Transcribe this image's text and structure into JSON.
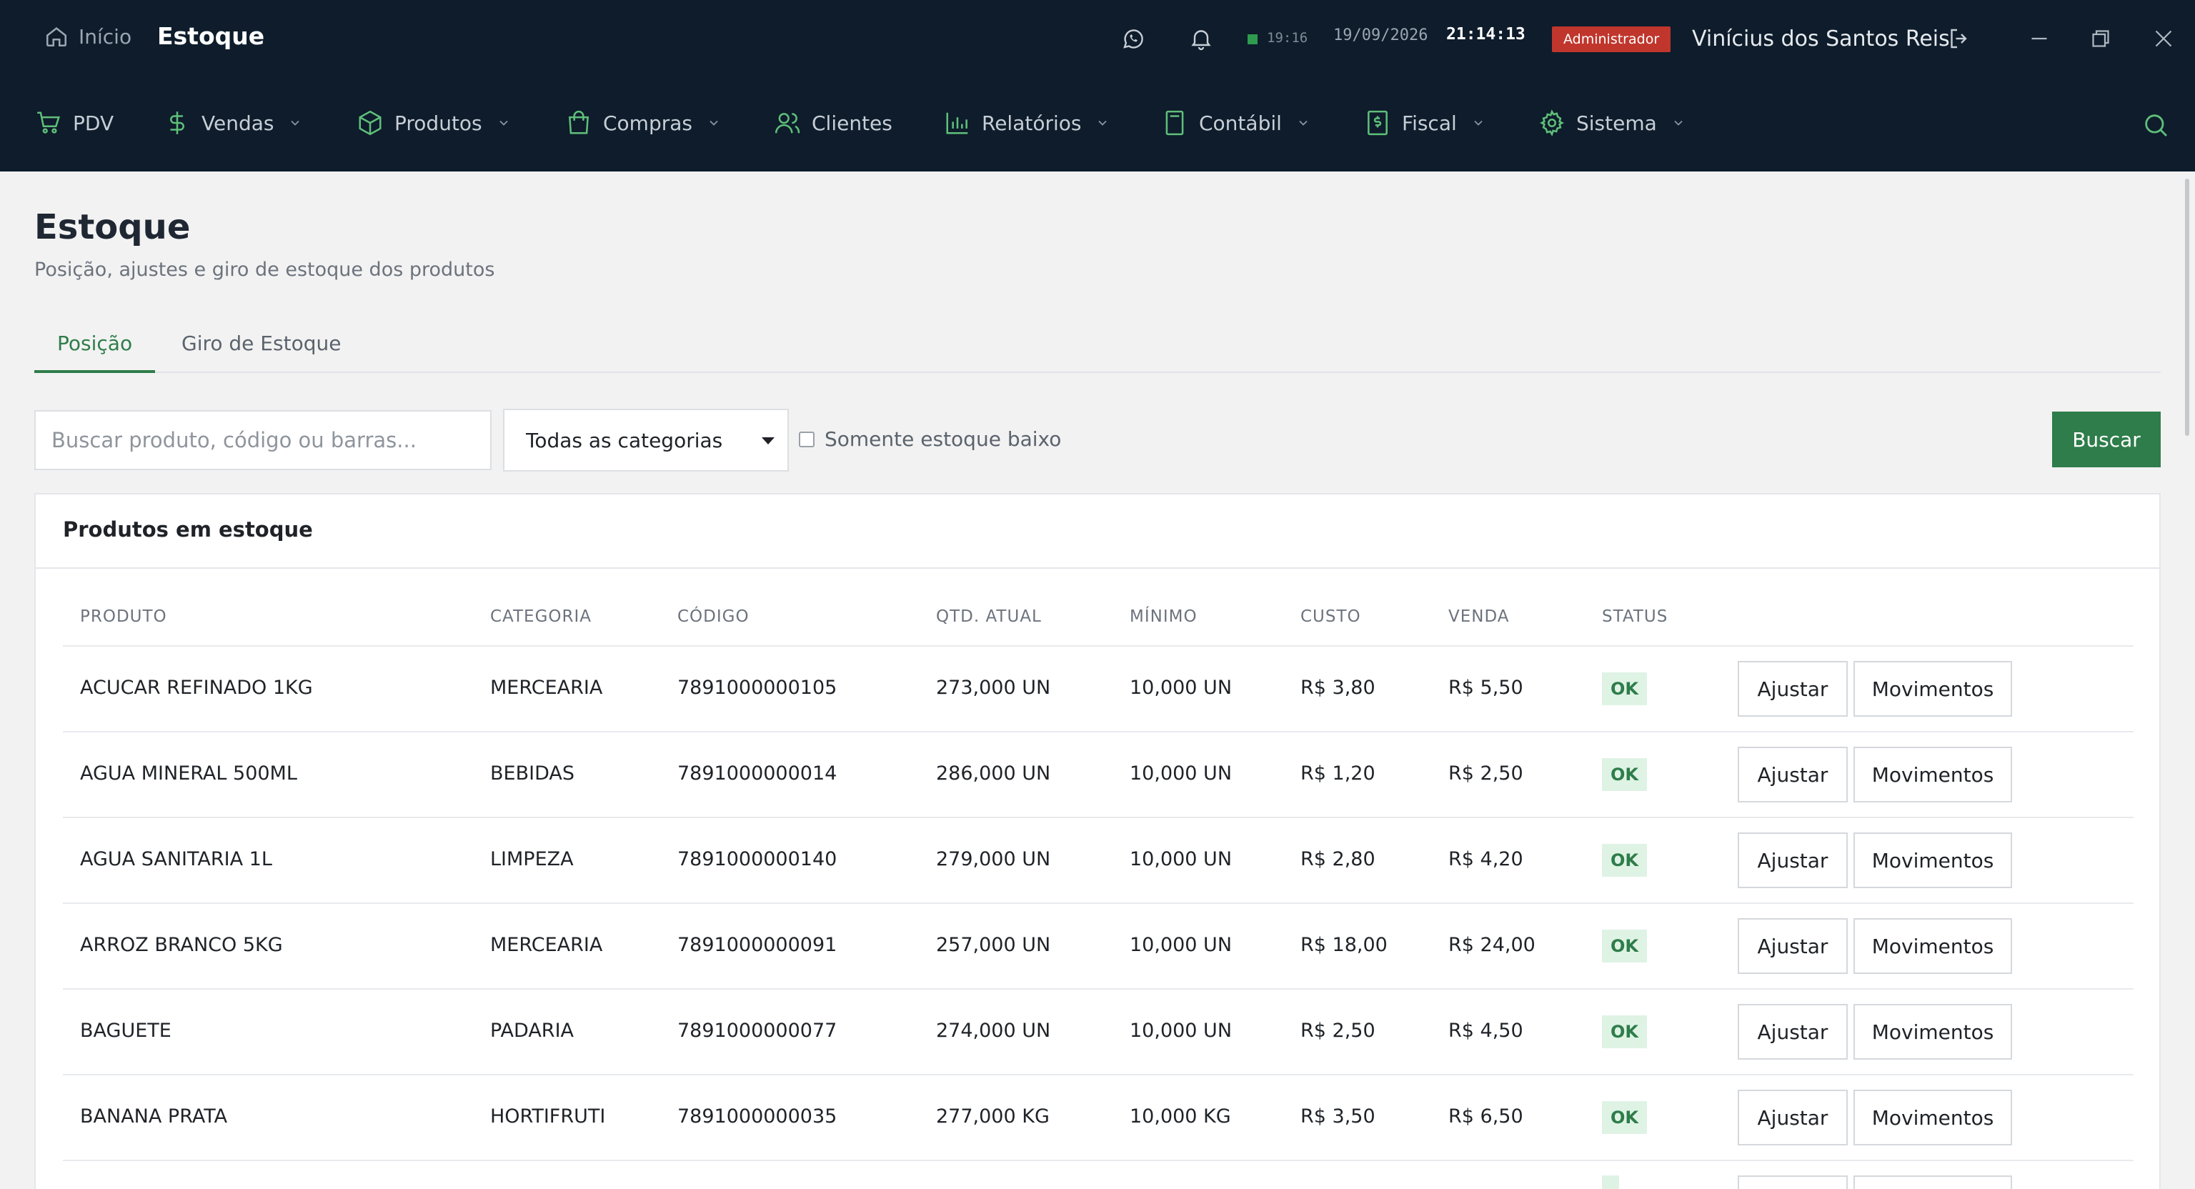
{
  "topbar": {
    "home_label": "Início",
    "title": "Estoque",
    "sync_time": "19:16",
    "date": "19/09/2026",
    "time": "21:14:13",
    "role": "Administrador",
    "user": "Vinícius dos Santos Reis"
  },
  "nav": {
    "items": [
      {
        "label": "PDV",
        "icon": "cart-icon"
      },
      {
        "label": "Vendas",
        "icon": "dollar-icon"
      },
      {
        "label": "Produtos",
        "icon": "box-icon"
      },
      {
        "label": "Compras",
        "icon": "bag-icon"
      },
      {
        "label": "Clientes",
        "icon": "users-icon"
      },
      {
        "label": "Relatórios",
        "icon": "bar-chart-icon"
      },
      {
        "label": "Contábil",
        "icon": "calculator-icon"
      },
      {
        "label": "Fiscal",
        "icon": "receipt-icon"
      },
      {
        "label": "Sistema",
        "icon": "gear-icon"
      }
    ]
  },
  "page": {
    "title": "Estoque",
    "subtitle": "Posição, ajustes e giro de estoque dos produtos"
  },
  "tabs": [
    {
      "label": "Posição",
      "active": true
    },
    {
      "label": "Giro de Estoque",
      "active": false
    }
  ],
  "filters": {
    "search_placeholder": "Buscar produto, código ou barras...",
    "category_selected": "Todas as categorias",
    "low_stock_label": "Somente estoque baixo",
    "search_button": "Buscar"
  },
  "table": {
    "title": "Produtos em estoque",
    "headers": [
      "PRODUTO",
      "CATEGORIA",
      "CÓDIGO",
      "QTD. ATUAL",
      "MÍNIMO",
      "CUSTO",
      "VENDA",
      "STATUS"
    ],
    "adjust_label": "Ajustar",
    "movements_label": "Movimentos",
    "rows": [
      {
        "produto": "ACUCAR REFINADO 1KG",
        "categoria": "MERCEARIA",
        "codigo": "7891000000105",
        "qtd": "273,000 UN",
        "minimo": "10,000 UN",
        "custo": "R$ 3,80",
        "venda": "R$ 5,50",
        "status": "OK"
      },
      {
        "produto": "AGUA MINERAL 500ML",
        "categoria": "BEBIDAS",
        "codigo": "7891000000014",
        "qtd": "286,000 UN",
        "minimo": "10,000 UN",
        "custo": "R$ 1,20",
        "venda": "R$ 2,50",
        "status": "OK"
      },
      {
        "produto": "AGUA SANITARIA 1L",
        "categoria": "LIMPEZA",
        "codigo": "7891000000140",
        "qtd": "279,000 UN",
        "minimo": "10,000 UN",
        "custo": "R$ 2,80",
        "venda": "R$ 4,20",
        "status": "OK"
      },
      {
        "produto": "ARROZ BRANCO 5KG",
        "categoria": "MERCEARIA",
        "codigo": "7891000000091",
        "qtd": "257,000 UN",
        "minimo": "10,000 UN",
        "custo": "R$ 18,00",
        "venda": "R$ 24,00",
        "status": "OK"
      },
      {
        "produto": "BAGUETE",
        "categoria": "PADARIA",
        "codigo": "7891000000077",
        "qtd": "274,000 UN",
        "minimo": "10,000 UN",
        "custo": "R$ 2,50",
        "venda": "R$ 4,50",
        "status": "OK"
      },
      {
        "produto": "BANANA PRATA",
        "categoria": "HORTIFRUTI",
        "codigo": "7891000000035",
        "qtd": "277,000 KG",
        "minimo": "10,000 KG",
        "custo": "R$ 3,50",
        "venda": "R$ 6,50",
        "status": "OK"
      }
    ]
  }
}
